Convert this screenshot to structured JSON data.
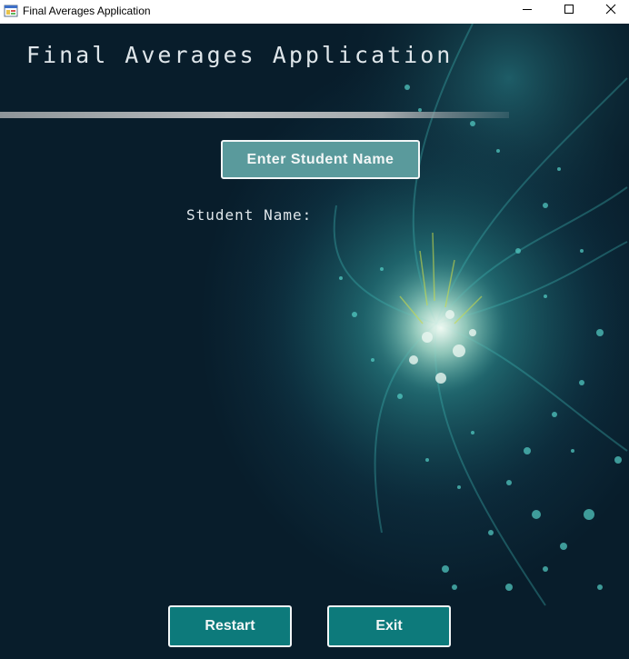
{
  "window": {
    "title": "Final Averages Application"
  },
  "header": {
    "title": "Final Averages Application"
  },
  "main": {
    "enter_button_label": "Enter Student Name",
    "student_name_label": "Student Name:"
  },
  "footer": {
    "restart_label": "Restart",
    "exit_label": "Exit"
  },
  "icons": {
    "app": "app-window-icon",
    "minimize": "minimize-icon",
    "maximize": "maximize-icon",
    "close": "close-icon"
  },
  "colors": {
    "background": "#081d2b",
    "accent_glow": "#2fb3b0",
    "enter_button": "#5a9a9c",
    "action_button": "#0d7a7b",
    "text": "#dfe6ea"
  }
}
